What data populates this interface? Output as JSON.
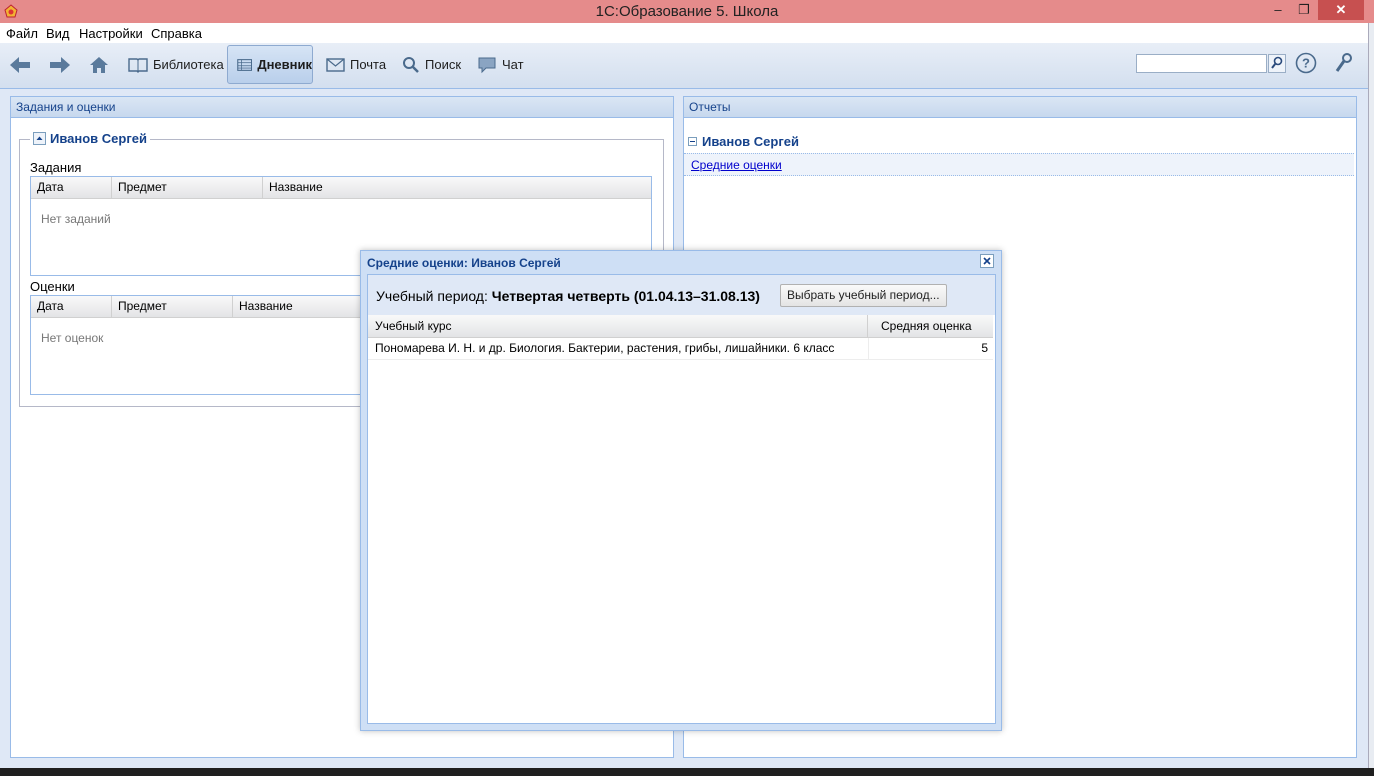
{
  "window": {
    "title": "1С:Образование 5. Школа",
    "min_glyph": "‒",
    "max_glyph": "❐",
    "close_glyph": "✕"
  },
  "menu": {
    "items": [
      "Файл",
      "Вид",
      "Настройки",
      "Справка"
    ]
  },
  "toolbar": {
    "library": "Библиотека",
    "diary": "Дневник",
    "mail": "Почта",
    "search": "Поиск",
    "chat": "Чат",
    "search_value": "",
    "active": "diary"
  },
  "left_panel": {
    "title": "Задания и оценки",
    "student": "Иванов Сергей",
    "tasks": {
      "label": "Задания",
      "columns": [
        "Дата",
        "Предмет",
        "Название"
      ],
      "empty_text": "Нет заданий"
    },
    "grades": {
      "label": "Оценки",
      "columns": [
        "Дата",
        "Предмет",
        "Название"
      ],
      "empty_text": "Нет оценок"
    }
  },
  "right_panel": {
    "title": "Отчеты",
    "student": "Иванов Сергей",
    "report_link": "Средние оценки"
  },
  "dialog": {
    "title": "Средние оценки: Иванов Сергей",
    "period_label": "Учебный период:",
    "period_value": "Четвертая четверть (01.04.13–31.08.13)",
    "choose_button": "Выбрать учебный период...",
    "columns": [
      "Учебный курс",
      "Средняя оценка"
    ],
    "rows": [
      {
        "course": "Пономарева И. Н. и др. Биология. Бактерии, растения, грибы, лишайники. 6 класс",
        "grade": "5"
      }
    ]
  },
  "colors": {
    "title_bar": "#e58b8b",
    "panel_header_text": "#15428b",
    "link": "#0000cc"
  }
}
